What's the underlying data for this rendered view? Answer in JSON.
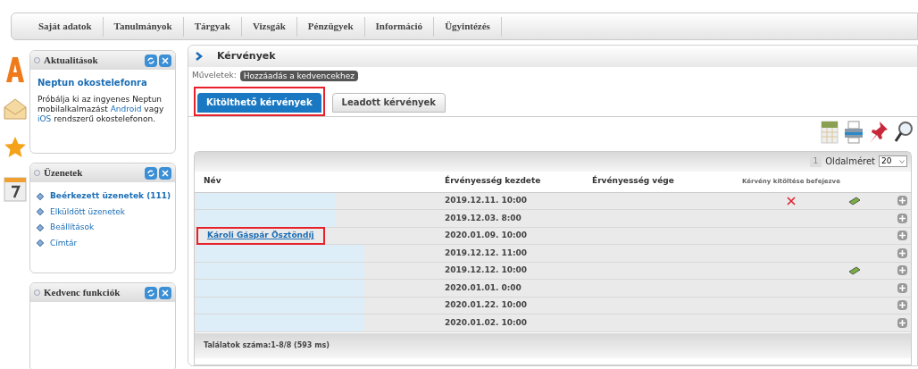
{
  "menu": [
    {
      "label": "Saját adatok"
    },
    {
      "label": "Tanulmányok"
    },
    {
      "label": "Tárgyak"
    },
    {
      "label": "Vizsgák"
    },
    {
      "label": "Pénzügyek"
    },
    {
      "label": "Információ"
    },
    {
      "label": "Ügyintézés"
    }
  ],
  "sidebar": {
    "boxes": [
      {
        "kind": "news",
        "title": "Aktualitások",
        "heading": "Neptun okostelefonra",
        "text_before": "Próbálja ki az ingyenes Neptun mobilalkalmazást",
        "link1": "Android",
        "text_mid": "vagy",
        "link2": "iOS",
        "text_after": "rendszerű okostelefonon."
      },
      {
        "kind": "links",
        "title": "Üzenetek",
        "items": [
          {
            "label": "Beérkezett üzenetek (111)",
            "bold": true
          },
          {
            "label": "Elküldött üzenetek",
            "bold": false
          },
          {
            "label": "Beállítások",
            "bold": false
          },
          {
            "label": "Címtár",
            "bold": false
          }
        ]
      },
      {
        "kind": "empty",
        "title": "Kedvenc funkciók"
      }
    ]
  },
  "page": {
    "title": "Kérvények",
    "actions_label": "Műveletek:",
    "action": "Hozzáadás a kedvencekhez",
    "tabs": [
      {
        "label": "Kitölthető kérvények",
        "selected": true,
        "highlighted": true
      },
      {
        "label": "Leadott kérvények",
        "selected": false,
        "highlighted": false
      }
    ],
    "pager": {
      "page": "1",
      "size_label": "Oldalméret",
      "size": "20"
    },
    "table": {
      "columns": [
        "Név",
        "Érvényesség kezdete",
        "Érvényesség vége",
        "Kérvény kitöltése befejezve"
      ],
      "rows": [
        {
          "redacted": true,
          "start": "2019.12.11. 10:00",
          "not_filled": true,
          "attachment": true
        },
        {
          "redacted": true,
          "start": "2019.12.03. 8:00",
          "not_filled": false,
          "attachment": false
        },
        {
          "redacted": false,
          "name": "Károli Gáspár Ösztöndíj",
          "highlighted": true,
          "start": "2020.01.09. 10:00",
          "not_filled": false,
          "attachment": false
        },
        {
          "redacted": true,
          "start": "2019.12.12. 11:00",
          "not_filled": false,
          "attachment": false
        },
        {
          "redacted": true,
          "start": "2019.12.12. 10:00",
          "not_filled": false,
          "attachment": true
        },
        {
          "redacted": true,
          "start": "2020.01.01. 0:00",
          "not_filled": false,
          "attachment": false
        },
        {
          "redacted": true,
          "start": "2020.01.22. 10:00",
          "not_filled": false,
          "attachment": false
        },
        {
          "redacted": true,
          "start": "2020.01.02. 10:00",
          "not_filled": false,
          "attachment": false
        }
      ],
      "footer": "Találatok száma:1-8/8 (593 ms)"
    }
  }
}
